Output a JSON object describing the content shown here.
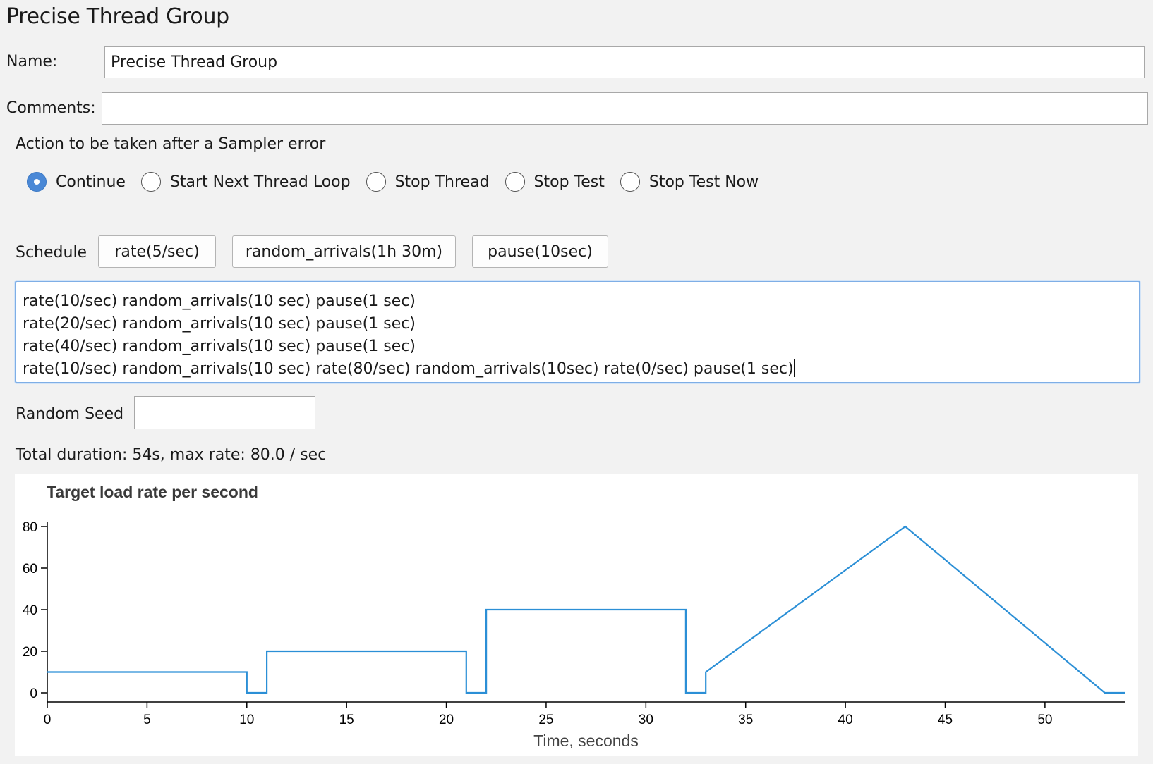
{
  "page_title": "Precise Thread Group",
  "name_label": "Name:",
  "name_value": "Precise Thread Group",
  "comments_label": "Comments:",
  "comments_value": "",
  "error_action": {
    "legend": "Action to be taken after a Sampler error",
    "options": [
      "Continue",
      "Start Next Thread Loop",
      "Stop Thread",
      "Stop Test",
      "Stop Test Now"
    ],
    "selected": "Continue"
  },
  "schedule": {
    "label": "Schedule",
    "buttons": [
      "rate(5/sec)",
      "random_arrivals(1h 30m)",
      "pause(10sec)"
    ],
    "lines": [
      "rate(10/sec) random_arrivals(10 sec) pause(1 sec)",
      "rate(20/sec) random_arrivals(10 sec) pause(1 sec)",
      "rate(40/sec) random_arrivals(10 sec) pause(1 sec)",
      "rate(10/sec) random_arrivals(10 sec) rate(80/sec) random_arrivals(10sec) rate(0/sec) pause(1 sec)"
    ]
  },
  "random_seed_label": "Random Seed",
  "random_seed_value": "",
  "summary": "Total duration: 54s, max rate: 80.0 / sec",
  "colors": {
    "line": "#2b8fd6",
    "radio_selected": "#4a88d6",
    "focus_border": "#7eaee6"
  },
  "chart_data": {
    "type": "line",
    "title": "Target load rate per second",
    "xlabel": "Time, seconds",
    "ylabel": "",
    "xlim": [
      0,
      54
    ],
    "ylim": [
      0,
      80
    ],
    "xticks": [
      0,
      5,
      10,
      15,
      20,
      25,
      30,
      35,
      40,
      45,
      50
    ],
    "yticks": [
      0,
      20,
      40,
      60,
      80
    ],
    "grid": false,
    "series": [
      {
        "x": [
          0,
          10,
          10,
          11,
          11,
          21,
          21,
          22,
          22,
          32,
          32,
          33,
          33,
          43,
          53,
          54
        ],
        "y": [
          10,
          10,
          0,
          0,
          20,
          20,
          0,
          0,
          40,
          40,
          0,
          0,
          10,
          80,
          0,
          0
        ]
      }
    ]
  }
}
